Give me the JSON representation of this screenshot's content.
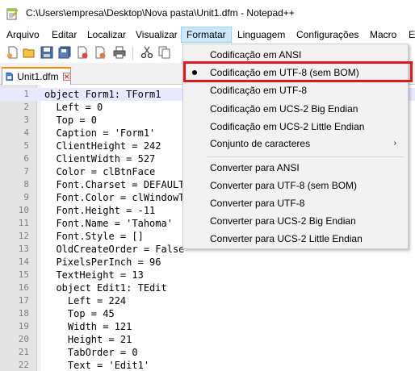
{
  "window": {
    "title": "C:\\Users\\empresa\\Desktop\\Nova pasta\\Unit1.dfm - Notepad++"
  },
  "menubar": {
    "items": [
      "Arquivo",
      "Editar",
      "Localizar",
      "Visualizar",
      "Formatar",
      "Linguagem",
      "Configurações",
      "Macro",
      "E"
    ],
    "active": "Formatar"
  },
  "tab": {
    "label": "Unit1.dfm"
  },
  "editor": {
    "lines": [
      {
        "n": "1",
        "text": "object Form1: TForm1"
      },
      {
        "n": "2",
        "text": "  Left = 0"
      },
      {
        "n": "3",
        "text": "  Top = 0"
      },
      {
        "n": "4",
        "text": "  Caption = 'Form1'"
      },
      {
        "n": "5",
        "text": "  ClientHeight = 242"
      },
      {
        "n": "6",
        "text": "  ClientWidth = 527"
      },
      {
        "n": "7",
        "text": "  Color = clBtnFace"
      },
      {
        "n": "8",
        "text": "  Font.Charset = DEFAULT_CHARSET"
      },
      {
        "n": "9",
        "text": "  Font.Color = clWindowText"
      },
      {
        "n": "10",
        "text": "  Font.Height = -11"
      },
      {
        "n": "11",
        "text": "  Font.Name = 'Tahoma'"
      },
      {
        "n": "12",
        "text": "  Font.Style = []"
      },
      {
        "n": "13",
        "text": "  OldCreateOrder = False"
      },
      {
        "n": "14",
        "text": "  PixelsPerInch = 96"
      },
      {
        "n": "15",
        "text": "  TextHeight = 13"
      },
      {
        "n": "16",
        "text": "  object Edit1: TEdit"
      },
      {
        "n": "17",
        "text": "    Left = 224"
      },
      {
        "n": "18",
        "text": "    Top = 45"
      },
      {
        "n": "19",
        "text": "    Width = 121"
      },
      {
        "n": "20",
        "text": "    Height = 21"
      },
      {
        "n": "21",
        "text": "    TabOrder = 0"
      },
      {
        "n": "22",
        "text": "    Text = 'Edit1'"
      }
    ]
  },
  "format_menu": {
    "group1": [
      {
        "label": "Codificação em ANSI",
        "selected": false
      },
      {
        "label": "Codificação em UTF-8 (sem BOM)",
        "selected": true
      },
      {
        "label": "Codificação em UTF-8",
        "selected": false
      },
      {
        "label": "Codificação em UCS-2 Big Endian",
        "selected": false
      },
      {
        "label": "Codificação em UCS-2 Little Endian",
        "selected": false
      },
      {
        "label": "Conjunto de caracteres",
        "selected": false,
        "submenu": true
      }
    ],
    "group2": [
      {
        "label": "Converter para ANSI"
      },
      {
        "label": "Converter para UTF-8 (sem BOM)"
      },
      {
        "label": "Converter para UTF-8"
      },
      {
        "label": "Converter para UCS-2 Big Endian"
      },
      {
        "label": "Converter para UCS-2 Little Endian"
      }
    ],
    "submenu_arrow": "›"
  },
  "toolbar": {
    "icons": [
      "new-file-icon",
      "open-file-icon",
      "save-icon",
      "save-all-icon",
      "close-icon",
      "close-all-icon",
      "print-icon",
      "cut-icon",
      "copy-icon"
    ]
  },
  "colors": {
    "highlight_box": "#e0191b",
    "menu_active_bg": "#cce8ff",
    "tab_accent": "#fa8a00",
    "current_line_bg": "#e8e8ff"
  }
}
